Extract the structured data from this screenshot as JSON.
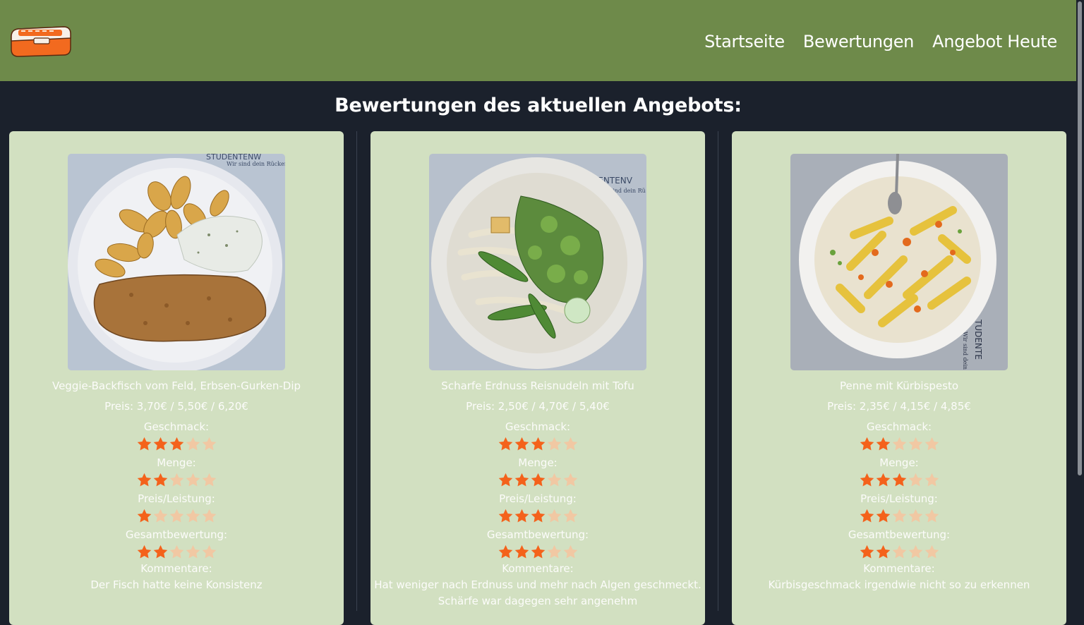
{
  "nav": {
    "items": [
      "Startseite",
      "Bewertungen",
      "Angebot Heute"
    ]
  },
  "page": {
    "title": "Bewertungen des aktuellen Angebots:"
  },
  "labels": {
    "taste": "Geschmack:",
    "amount": "Menge:",
    "value": "Preis/Leistung:",
    "overall": "Gesamtbewertung:",
    "comments": "Kommentare:"
  },
  "colors": {
    "header": "#6e8a4a",
    "background": "#1b212c",
    "card": "#d2e0c1",
    "star_filled": "#f4621b",
    "star_empty": "#f1c8a3"
  },
  "icons": {
    "logo": "lunchbox-logo-icon",
    "star": "star-icon"
  },
  "cards": [
    {
      "name": "Veggie-Backfisch vom Feld, Erbsen-Gurken-Dip",
      "price": "Preis: 3,70€ / 5,50€ / 6,20€",
      "ratings": {
        "taste": 3,
        "amount": 2,
        "value": 1,
        "overall": 2
      },
      "comment_lines": [
        "Der Fisch hatte keine Konsistenz"
      ],
      "photo_text": [
        "STUDENTENW",
        "Wir sind dein Rücken"
      ]
    },
    {
      "name": "Scharfe Erdnuss Reisnudeln mit Tofu",
      "price": "Preis: 2,50€ / 4,70€ / 5,40€",
      "ratings": {
        "taste": 3,
        "amount": 3,
        "value": 3,
        "overall": 3
      },
      "comment_lines": [
        "Hat weniger nach Erdnuss und mehr nach Algen geschmeckt.",
        "Schärfe war dagegen sehr angenehm"
      ],
      "photo_text": [
        "DENTENV",
        "sind dein Rü"
      ]
    },
    {
      "name": "Penne mit Kürbispesto",
      "price": "Preis: 2,35€ / 4,15€ / 4,85€",
      "ratings": {
        "taste": 2,
        "amount": 3,
        "value": 2,
        "overall": 2
      },
      "comment_lines": [
        "Kürbisgeschmack irgendwie nicht so zu erkennen"
      ],
      "photo_text": [
        "TUDENTE",
        "Wir sind dein"
      ]
    }
  ]
}
